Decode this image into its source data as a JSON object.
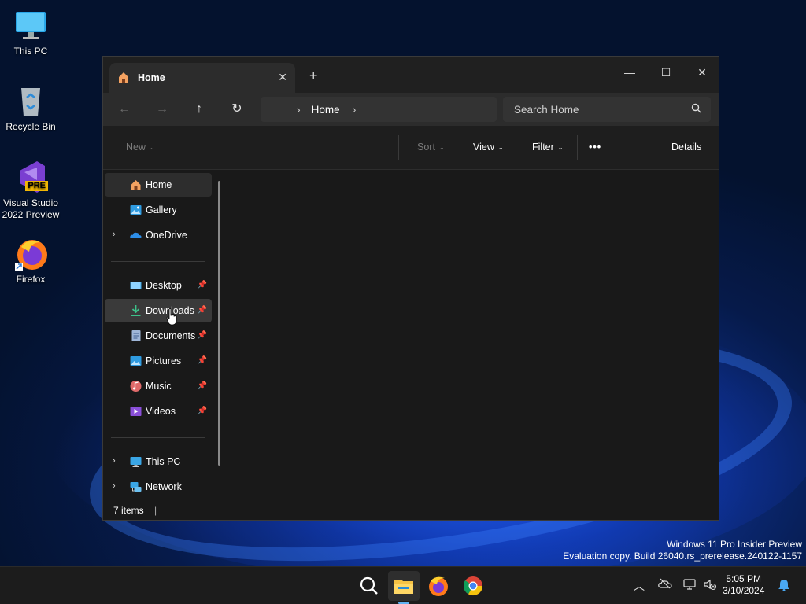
{
  "desktop": {
    "icons": [
      {
        "label": "This PC"
      },
      {
        "label": "Recycle Bin"
      },
      {
        "label": "Visual Studio 2022 Preview",
        "badge": "PRE"
      },
      {
        "label": "Firefox"
      }
    ],
    "watermark": {
      "line1": "Windows 11 Pro Insider Preview",
      "line2": "Evaluation copy. Build 26040.rs_prerelease.240122-1157"
    }
  },
  "explorer": {
    "tab": {
      "title": "Home",
      "close": "✕"
    },
    "new_tab": "+",
    "caption": {
      "minimize": "—",
      "maximize": "☐",
      "close": "✕"
    },
    "address": {
      "crumb": "Home"
    },
    "search": {
      "placeholder": "Search Home"
    },
    "commands": {
      "new": "New",
      "sort": "Sort",
      "view": "View",
      "filter": "Filter",
      "more": "•••",
      "details": "Details"
    },
    "sidebar": {
      "quick": [
        {
          "label": "Home",
          "icon": "home-icon"
        },
        {
          "label": "Gallery",
          "icon": "gallery-icon"
        },
        {
          "label": "OneDrive",
          "icon": "cloud-icon"
        }
      ],
      "pinned": [
        {
          "label": "Desktop",
          "icon": "desktop-icon"
        },
        {
          "label": "Downloads",
          "icon": "download-icon"
        },
        {
          "label": "Documents",
          "icon": "document-icon"
        },
        {
          "label": "Pictures",
          "icon": "pictures-icon"
        },
        {
          "label": "Music",
          "icon": "music-icon"
        },
        {
          "label": "Videos",
          "icon": "video-icon"
        }
      ],
      "drives": [
        {
          "label": "This PC",
          "icon": "pc-icon"
        },
        {
          "label": "Network",
          "icon": "network-icon"
        }
      ]
    },
    "status": {
      "items": "7 items"
    }
  },
  "taskbar": {
    "clock": {
      "time": "5:05 PM",
      "date": "3/10/2024"
    },
    "apps": [
      "search-icon",
      "file-explorer-icon",
      "firefox-icon",
      "chrome-icon"
    ]
  },
  "colors": {
    "window_bg": "#191919",
    "titlebar": "#202020",
    "accent": "#5fb2f2"
  }
}
